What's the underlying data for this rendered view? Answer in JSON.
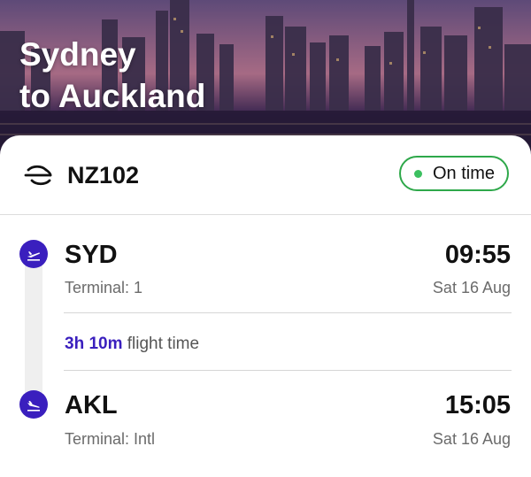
{
  "hero": {
    "title_line1": "Sydney",
    "title_line2": "to Auckland"
  },
  "flight": {
    "airline_icon": "air-new-zealand-koru-icon",
    "number": "NZ102",
    "status": "On time",
    "status_color": "#2ea84a"
  },
  "departure": {
    "icon": "takeoff-icon",
    "code": "SYD",
    "terminal": "Terminal: 1",
    "time": "09:55",
    "date": "Sat 16 Aug"
  },
  "duration": {
    "value": "3h 10m",
    "label": "flight time"
  },
  "arrival": {
    "icon": "landing-icon",
    "code": "AKL",
    "terminal": "Terminal: Intl",
    "time": "15:05",
    "date": "Sat 16 Aug"
  },
  "colors": {
    "accent": "#3a1fbe",
    "status_green": "#2ea84a",
    "muted_text": "#6b6b6b"
  }
}
